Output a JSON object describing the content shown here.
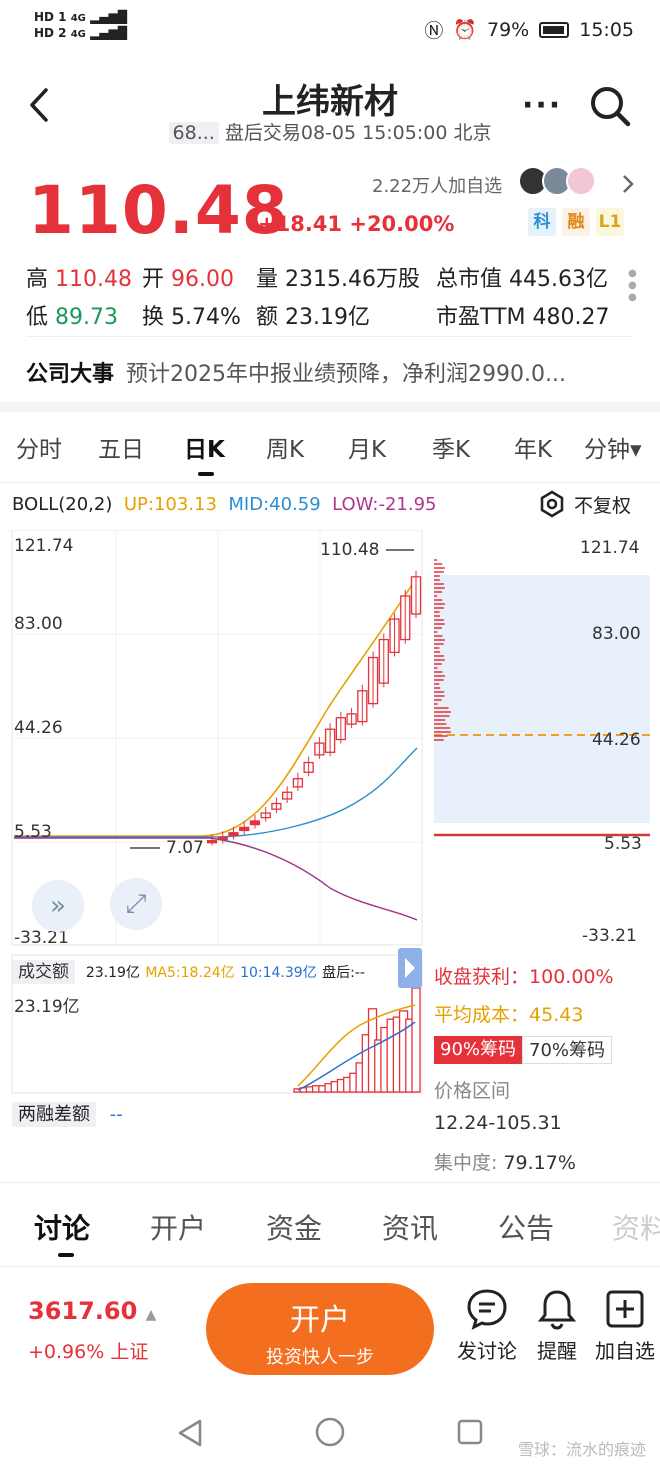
{
  "status_bar": {
    "sim1": "HD 1",
    "sim2": "HD 2",
    "net1": "4G",
    "net2": "4G",
    "battery": "79%",
    "time": "15:05"
  },
  "header": {
    "title": "上纬新材",
    "code": "68...",
    "subtitle": "盘后交易08-05 15:05:00 北京"
  },
  "quote": {
    "price": "110.48",
    "change": "+18.41",
    "change_pct": "+20.00%",
    "watchers": "2.22万人加自选",
    "tags": [
      "科",
      "融",
      "L1"
    ]
  },
  "stats": {
    "high_label": "高",
    "high": "110.48",
    "open_label": "开",
    "open": "96.00",
    "volume_label": "量",
    "volume": "2315.46万股",
    "mktcap_label": "总市值",
    "mktcap": "445.63亿",
    "low_label": "低",
    "low": "89.73",
    "turnover_label": "换",
    "turnover": "5.74%",
    "amount_label": "额",
    "amount": "23.19亿",
    "pe_label": "市盈TTM",
    "pe": "480.27"
  },
  "event": {
    "label": "公司大事",
    "text": "预计2025年中报业绩预降，净利润2990.0..."
  },
  "period_tabs": [
    "分时",
    "五日",
    "日K",
    "周K",
    "月K",
    "季K",
    "年K",
    "分钟▾"
  ],
  "indicator": {
    "name": "BOLL(20,2)",
    "up": "UP:103.13",
    "mid": "MID:40.59",
    "low": "LOW:-21.95",
    "adjust": "不复权"
  },
  "chart_axis": {
    "left": [
      "121.74",
      "83.00",
      "44.26",
      "5.53",
      "-33.21"
    ],
    "right": [
      "121.74",
      "83.00",
      "44.26",
      "5.53",
      "-33.21"
    ],
    "high_marker": "110.48",
    "low_marker": "7.07"
  },
  "chart_data": {
    "type": "candlestick",
    "ylim": [
      -33.21,
      121.74
    ],
    "candles": [
      {
        "o": 7.2,
        "c": 7.5
      },
      {
        "o": 8.0,
        "c": 8.8
      },
      {
        "o": 9.6,
        "c": 10.6
      },
      {
        "o": 11.5,
        "c": 12.7
      },
      {
        "o": 13.8,
        "c": 15.2
      },
      {
        "o": 16.5,
        "c": 18.3
      },
      {
        "o": 19.8,
        "c": 22.0
      },
      {
        "o": 23.8,
        "c": 26.4
      },
      {
        "o": 28.5,
        "c": 31.7
      },
      {
        "o": 34.2,
        "c": 38.0
      },
      {
        "o": 41.0,
        "c": 45.6
      },
      {
        "o": 42.0,
        "c": 51.0
      },
      {
        "o": 47.0,
        "c": 55.5
      },
      {
        "o": 53.0,
        "c": 57.0
      },
      {
        "o": 54.0,
        "c": 66.0
      },
      {
        "o": 61.0,
        "c": 79.0
      },
      {
        "o": 69.0,
        "c": 86.0
      },
      {
        "o": 81.0,
        "c": 94.0
      },
      {
        "o": 86.0,
        "c": 103.0
      },
      {
        "o": 96.0,
        "c": 110.48
      }
    ],
    "volume_max": "23.19亿"
  },
  "volume": {
    "label": "成交额",
    "value": "23.19亿",
    "ma5": "MA5:18.24亿",
    "ma10": "10:14.39亿",
    "after": "盘后:--",
    "axis_top": "23.19亿"
  },
  "margin": {
    "label": "两融差额",
    "value": "--"
  },
  "cost_dist": {
    "profit_label": "收盘获利：",
    "profit": "100.00%",
    "avg_label": "平均成本：",
    "avg": "45.43",
    "chip90": "90%筹码",
    "chip70": "70%筹码",
    "range_label": "价格区间",
    "range": "12.24-105.31",
    "conc_label": "集中度:",
    "conc": "79.17%"
  },
  "bottom_tabs": [
    "讨论",
    "开户",
    "资金",
    "资讯",
    "公告",
    "资料"
  ],
  "dock": {
    "index_value": "3617.60",
    "index_change": "+0.96% 上证",
    "open_title": "开户",
    "open_sub": "投资快人一步",
    "discuss": "发讨论",
    "remind": "提醒",
    "add_watch": "加自选"
  },
  "watermark": "雪球：流水的痕迹"
}
